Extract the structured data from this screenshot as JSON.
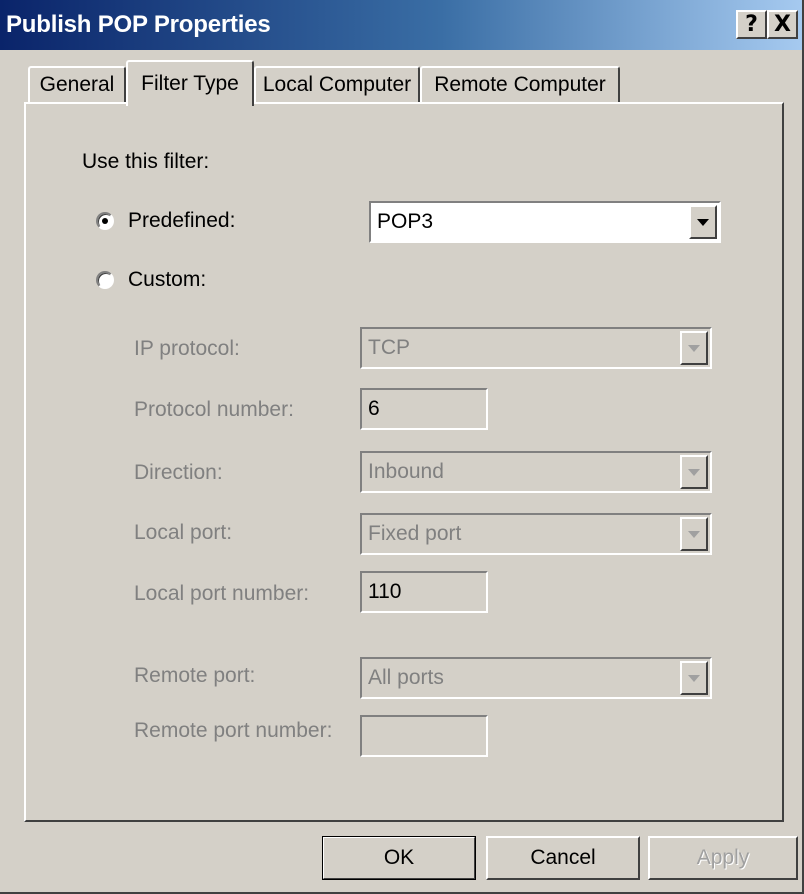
{
  "window": {
    "title": "Publish POP Properties",
    "help_label": "?",
    "close_label": "X"
  },
  "tabs": [
    {
      "label": "General",
      "active": false
    },
    {
      "label": "Filter Type",
      "active": true
    },
    {
      "label": "Local Computer",
      "active": false
    },
    {
      "label": "Remote Computer",
      "active": false
    }
  ],
  "filter": {
    "heading": "Use this filter:",
    "predefined_label": "Predefined:",
    "predefined_value": "POP3",
    "custom_label": "Custom:",
    "selected": "predefined"
  },
  "custom": {
    "ip_protocol_label": "IP protocol:",
    "ip_protocol_value": "TCP",
    "protocol_number_label": "Protocol number:",
    "protocol_number_value": "6",
    "direction_label": "Direction:",
    "direction_value": "Inbound",
    "local_port_label": "Local port:",
    "local_port_value": "Fixed port",
    "local_port_number_label": "Local port number:",
    "local_port_number_value": "110",
    "remote_port_label": "Remote port:",
    "remote_port_value": "All ports",
    "remote_port_number_label": "Remote port number:",
    "remote_port_number_value": ""
  },
  "buttons": {
    "ok": "OK",
    "cancel": "Cancel",
    "apply": "Apply"
  }
}
